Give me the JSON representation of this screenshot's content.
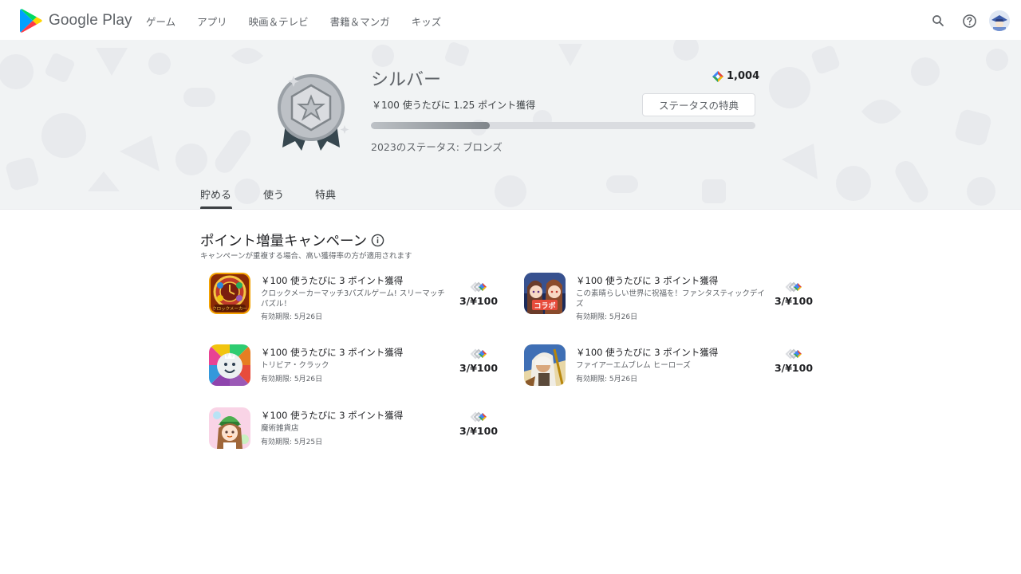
{
  "brand": {
    "name": "Google Play"
  },
  "nav": [
    {
      "label": "ゲーム"
    },
    {
      "label": "アプリ"
    },
    {
      "label": "映画＆テレビ"
    },
    {
      "label": "書籍＆マンガ"
    },
    {
      "label": "キッズ"
    }
  ],
  "topbar": {
    "icons": [
      "search-icon",
      "help-icon",
      "account-avatar"
    ]
  },
  "tier": {
    "name": "シルバー",
    "points": "1,004",
    "rate_text": "￥100 使うたびに 1.25 ポイント獲得",
    "status_button": "ステータスの特典",
    "progress_fraction": 0.31,
    "previous_status": "2023のステータス: ブロンズ"
  },
  "tabs": [
    {
      "label": "貯める",
      "active": true
    },
    {
      "label": "使う",
      "active": false
    },
    {
      "label": "特典",
      "active": false
    }
  ],
  "campaign": {
    "title": "ポイント増量キャンペーン",
    "subtitle": "キャンペーンが重複する場合、高い獲得率の方が適用されます",
    "offers": [
      {
        "title": "￥100 使うたびに 3 ポイント獲得",
        "app": "クロックメーカーマッチ3パズルゲーム! スリーマッチパズル！",
        "expires": "有効期限: 5月26日",
        "reward": "3/¥100"
      },
      {
        "title": "￥100 使うたびに 3 ポイント獲得",
        "app": "この素晴らしい世界に祝福を！ファンタスティックデイズ",
        "expires": "有効期限: 5月26日",
        "reward": "3/¥100"
      },
      {
        "title": "￥100 使うたびに 3 ポイント獲得",
        "app": "トリビア・クラック",
        "expires": "有効期限: 5月26日",
        "reward": "3/¥100"
      },
      {
        "title": "￥100 使うたびに 3 ポイント獲得",
        "app": "ファイアーエムブレム ヒーローズ",
        "expires": "有効期限: 5月26日",
        "reward": "3/¥100"
      },
      {
        "title": "￥100 使うたびに 3 ポイント獲得",
        "app": "魔術雑貨店",
        "expires": "有効期限: 5月25日",
        "reward": "3/¥100"
      }
    ],
    "icon_labels": {
      "clock": "クロックメーカー",
      "collab": "コラボ"
    }
  },
  "colors": {
    "accent": "#3c4043",
    "play_green": "#01875f",
    "hero_bg": "#f1f3f4"
  }
}
